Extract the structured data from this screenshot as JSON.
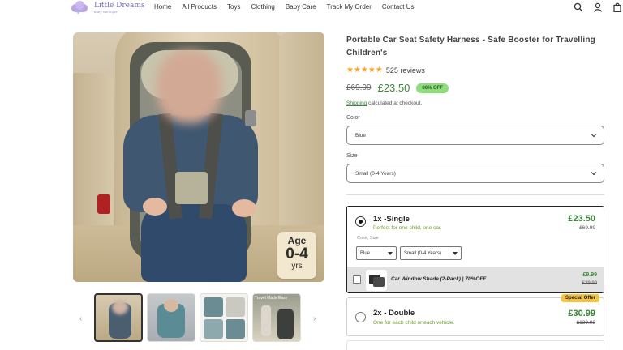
{
  "header": {
    "logo_title": "Little Dreams",
    "logo_tagline": "baby boutique",
    "nav": [
      "Home",
      "All Products",
      "Toys",
      "Clothing",
      "Baby Care",
      "Track My Order",
      "Contact Us"
    ],
    "icons": [
      "search-icon",
      "account-icon",
      "cart-icon"
    ]
  },
  "gallery": {
    "age_badge": {
      "line1": "Age",
      "line2": "0-4",
      "line3": "yrs"
    },
    "thumbnail_count": 4,
    "thumb4_label": "Travel Made Easy"
  },
  "product": {
    "title": "Portable Car Seat Safety Harness - Safe Booster for Travelling Children's",
    "stars": "★★★★★",
    "reviews": "525 reviews",
    "old_price": "£69.99",
    "price": "£23.50",
    "discount_badge": "66% OFF",
    "shipping_link": "Shipping",
    "shipping_text": " calculated at checkout."
  },
  "options": {
    "color_label": "Color",
    "color_value": "Blue",
    "size_label": "Size",
    "size_value": "Small (0-4 Years)"
  },
  "bundles": [
    {
      "title": "1x -Single",
      "subtitle": "Perfect for one child, one car.",
      "price": "£23.50",
      "old_price": "£69.99",
      "selected": true,
      "variant_label": "Color, Size",
      "variant_color": "Blue",
      "variant_size": "Small (0-4 Years)",
      "upsell": {
        "text": "Car Window Shade (2-Pack) | 70%OFF",
        "price": "£9.99",
        "old_price": "£29.99"
      }
    },
    {
      "title": "2x - Double",
      "subtitle": "One for each child or each vehicle.",
      "price": "£30.99",
      "old_price": "£139.98",
      "selected": false,
      "badge": "Special Offer"
    }
  ],
  "colors": {
    "accent_green": "#3a8a3a",
    "badge_green": "#8fdc7c",
    "star_gold": "#f2a623",
    "special_offer_yellow": "#f5c242"
  }
}
